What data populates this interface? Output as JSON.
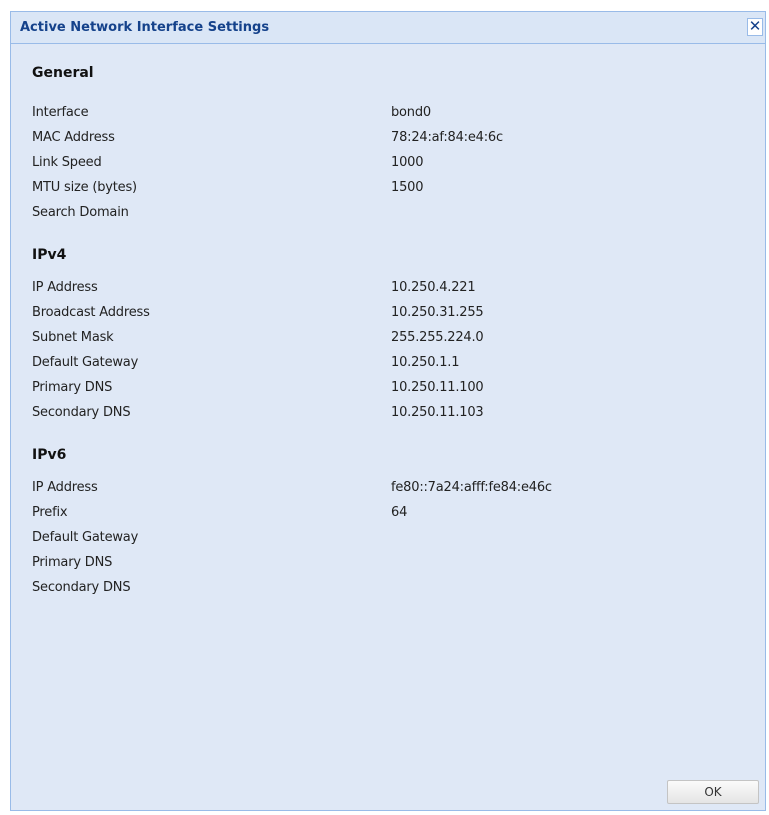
{
  "dialog": {
    "title": "Active Network Interface Settings",
    "close_glyph": "✕"
  },
  "general": {
    "title": "General",
    "rows": [
      {
        "label": "Interface",
        "value": "bond0"
      },
      {
        "label": "MAC Address",
        "value": "78:24:af:84:e4:6c"
      },
      {
        "label": "Link Speed",
        "value": "1000"
      },
      {
        "label": "MTU size (bytes)",
        "value": "1500"
      },
      {
        "label": "Search Domain",
        "value": ""
      }
    ]
  },
  "ipv4": {
    "title": "IPv4",
    "rows": [
      {
        "label": "IP Address",
        "value": "10.250.4.221"
      },
      {
        "label": "Broadcast Address",
        "value": "10.250.31.255"
      },
      {
        "label": "Subnet Mask",
        "value": "255.255.224.0"
      },
      {
        "label": "Default Gateway",
        "value": "10.250.1.1"
      },
      {
        "label": "Primary DNS",
        "value": "10.250.11.100"
      },
      {
        "label": "Secondary DNS",
        "value": "10.250.11.103"
      }
    ]
  },
  "ipv6": {
    "title": "IPv6",
    "rows": [
      {
        "label": "IP Address",
        "value": "fe80::7a24:afff:fe84:e46c"
      },
      {
        "label": "Prefix",
        "value": "64"
      },
      {
        "label": "Default Gateway",
        "value": ""
      },
      {
        "label": "Primary DNS",
        "value": ""
      },
      {
        "label": "Secondary DNS",
        "value": ""
      }
    ]
  },
  "footer": {
    "ok_label": "OK"
  },
  "colors": {
    "window_background": "#dfe8f6",
    "border": "#99bbe8",
    "title_text": "#15428b"
  },
  "icons": {
    "close": "close-icon"
  }
}
